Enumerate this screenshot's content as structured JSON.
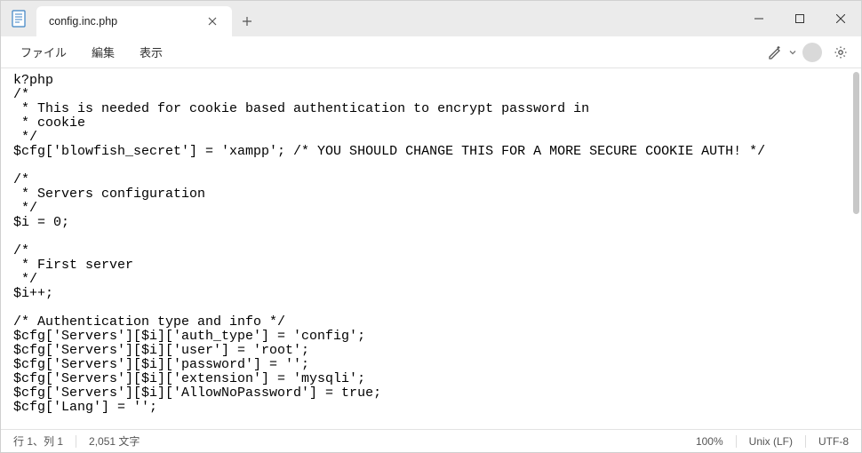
{
  "tab": {
    "title": "config.inc.php"
  },
  "menu": {
    "file": "ファイル",
    "edit": "編集",
    "view": "表示"
  },
  "editor": {
    "lines": [
      "k?php",
      "/*",
      " * This is needed for cookie based authentication to encrypt password in",
      " * cookie",
      " */",
      "$cfg['blowfish_secret'] = 'xampp'; /* YOU SHOULD CHANGE THIS FOR A MORE SECURE COOKIE AUTH! */",
      "",
      "/*",
      " * Servers configuration",
      " */",
      "$i = 0;",
      "",
      "/*",
      " * First server",
      " */",
      "$i++;",
      "",
      "/* Authentication type and info */",
      "$cfg['Servers'][$i]['auth_type'] = 'config';",
      "$cfg['Servers'][$i]['user'] = 'root';",
      "$cfg['Servers'][$i]['password'] = '';",
      "$cfg['Servers'][$i]['extension'] = 'mysqli';",
      "$cfg['Servers'][$i]['AllowNoPassword'] = true;",
      "$cfg['Lang'] = '';"
    ]
  },
  "status": {
    "position": "行 1、列 1",
    "chars": "2,051 文字",
    "zoom": "100%",
    "eol": "Unix (LF)",
    "encoding": "UTF-8"
  }
}
